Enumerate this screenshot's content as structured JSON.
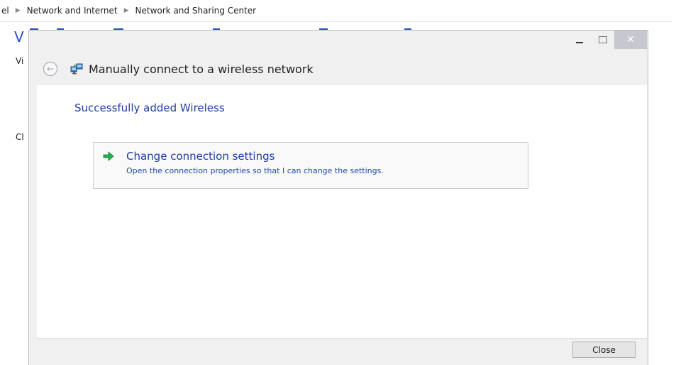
{
  "background": {
    "breadcrumb": [
      "el",
      "Network and Internet",
      "Network and Sharing Center"
    ],
    "heading_fragment": "V",
    "left_fragments": [
      "Vi",
      "Cl"
    ]
  },
  "dialog": {
    "title": "Manually connect to a wireless network",
    "success_message": "Successfully added Wireless",
    "option": {
      "title": "Change connection settings",
      "description": "Open the connection properties so that I can change the settings."
    },
    "close_label": "Close",
    "window_close_glyph": "✕"
  },
  "colors": {
    "heading_blue": "#1f3f9d",
    "link_blue": "#1c3f9f",
    "arrow_green": "#22b14c"
  }
}
